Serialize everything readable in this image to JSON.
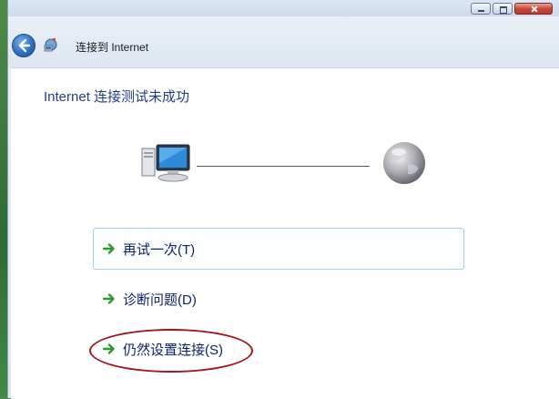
{
  "window": {
    "title": "连接到 Internet",
    "caption_buttons": [
      "minimize-icon",
      "maximize-icon",
      "close-icon"
    ]
  },
  "navigation": {
    "back_icon": "back-arrow-icon",
    "wizard_icon": "network-wizard-icon"
  },
  "content": {
    "heading": "Internet 连接测试未成功",
    "diagram": {
      "left_icon": "computer-icon",
      "right_icon": "globe-icon"
    },
    "options": [
      {
        "label": "再试一次(T)",
        "icon": "green-arrow-icon",
        "focused": true
      },
      {
        "label": "诊断问题(D)",
        "icon": "green-arrow-icon",
        "focused": false
      },
      {
        "label": "仍然设置连接(S)",
        "icon": "green-arrow-icon",
        "focused": false,
        "circled": true
      }
    ]
  },
  "colors": {
    "heading": "#1f3f8a",
    "option_text": "#0a246a",
    "arrow": "#2e9a2e",
    "highlight": "#a3161c",
    "focus_border": "#9fd2e8"
  }
}
